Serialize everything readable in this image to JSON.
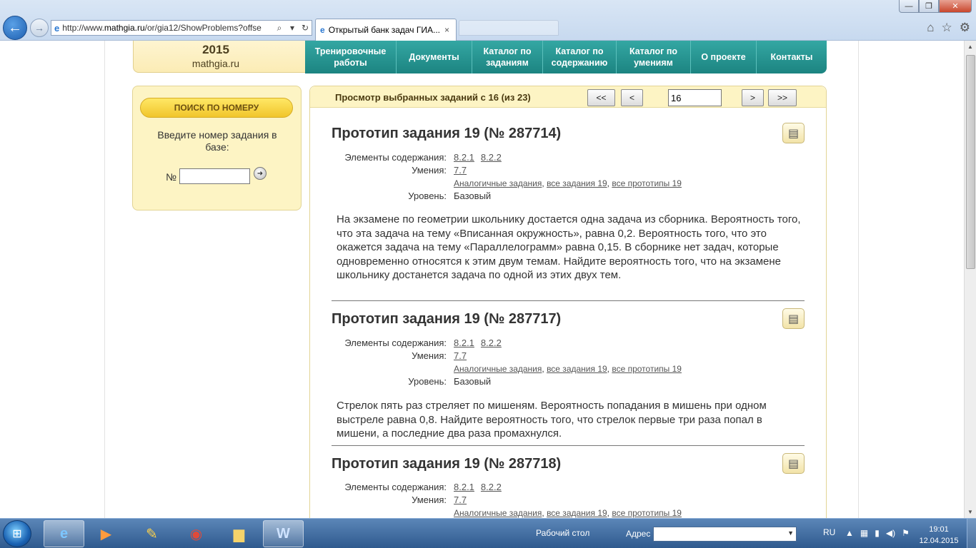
{
  "browser": {
    "url_prefix": "http://www.",
    "url_domain": "mathgia.ru",
    "url_rest": "/or/gia12/ShowProblems?offse",
    "tab_title": "Открытый банк задач ГИА...",
    "tab_close": "×",
    "back": "←",
    "forward": "→",
    "minimize": "—",
    "maximize": "❐",
    "close": "✕"
  },
  "site": {
    "year": "2015",
    "name": "mathgia.ru",
    "nav": [
      {
        "label": "Тренировочные работы"
      },
      {
        "label": "Документы"
      },
      {
        "label": "Каталог по заданиям"
      },
      {
        "label": "Каталог по содержанию"
      },
      {
        "label": "Каталог по умениям"
      },
      {
        "label": "О проекте"
      },
      {
        "label": "Контакты"
      }
    ]
  },
  "search": {
    "title": "ПОИСК ПО НОМЕРУ",
    "hint": "Введите номер задания в базе:",
    "num_label": "№",
    "value": ""
  },
  "content": {
    "header_title": "Просмотр выбранных заданий с 16 (из 23)",
    "pager": {
      "first": "<<",
      "prev": "<",
      "current": "16",
      "next": ">",
      "last": ">>"
    },
    "labels": {
      "elements": "Элементы содержания:",
      "skills": "Умения:",
      "level": "Уровень:"
    },
    "problems": [
      {
        "title": "Прототип задания 19 (№ 287714)",
        "elements": [
          "8.2.1",
          "8.2.2"
        ],
        "skills": [
          "7.7"
        ],
        "links": [
          "Аналогичные задания",
          "все задания 19",
          "все прототипы 19"
        ],
        "level": "Базовый",
        "text": "На экзамене по геометрии школьнику достается одна задача из сборника. Вероятность того, что эта задача на тему «Вписанная окружность», равна 0,2. Вероятность того, что это окажется задача на тему «Параллелограмм» равна 0,15. В сборнике нет задач, которые одновременно относятся к этим двум темам. Найдите вероятность того, что на экзамене школьнику достанется задача по одной из этих двух тем."
      },
      {
        "title": "Прототип задания 19 (№ 287717)",
        "elements": [
          "8.2.1",
          "8.2.2"
        ],
        "skills": [
          "7.7"
        ],
        "links": [
          "Аналогичные задания",
          "все задания 19",
          "все прототипы 19"
        ],
        "level": "Базовый",
        "text": "Стрелок пять раз стреляет по мишеням. Вероятность попадания в мишень при одном выстреле равна 0,8. Найдите вероятность того, что стрелок первые три раза попал в мишени, а последние два раза промахнулся."
      },
      {
        "title": "Прототип задания 19 (№ 287718)",
        "elements": [
          "8.2.1",
          "8.2.2"
        ],
        "skills": [
          "7.7"
        ],
        "links": [
          "Аналогичные задания",
          "все задания 19",
          "все прототипы 19"
        ],
        "level": "",
        "text": ""
      }
    ]
  },
  "taskbar": {
    "desktop": "Рабочий стол",
    "address_label": "Адрес",
    "address_value": "",
    "lang": "RU",
    "time": "19:01",
    "date": "12.04.2015"
  }
}
